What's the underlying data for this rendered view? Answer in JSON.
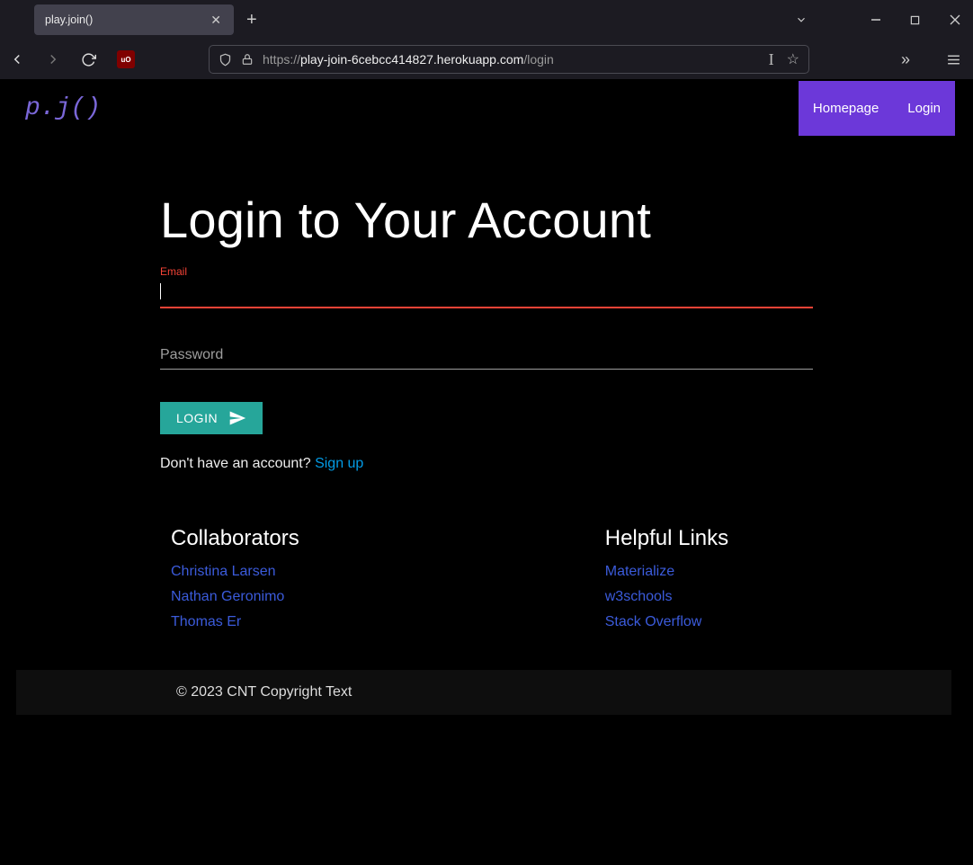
{
  "browser": {
    "tab_title": "play.join()",
    "url_prefix": "https://",
    "url_host": "play-join-6cebcc414827.herokuapp.com",
    "url_path": "/login"
  },
  "nav": {
    "logo": "p.j()",
    "items": [
      "Homepage",
      "Login"
    ]
  },
  "page": {
    "title": "Login to Your Account",
    "email_label": "Email",
    "password_label": "Password",
    "login_button": "LOGIN",
    "signup_prompt": "Don't have an account? ",
    "signup_link": "Sign up"
  },
  "footer": {
    "collaborators_heading": "Collaborators",
    "collaborators": [
      "Christina Larsen",
      "Nathan Geronimo",
      "Thomas Er"
    ],
    "links_heading": "Helpful Links",
    "links": [
      "Materialize",
      "w3schools",
      "Stack Overflow"
    ],
    "copyright": "© 2023 CNT Copyright Text"
  }
}
